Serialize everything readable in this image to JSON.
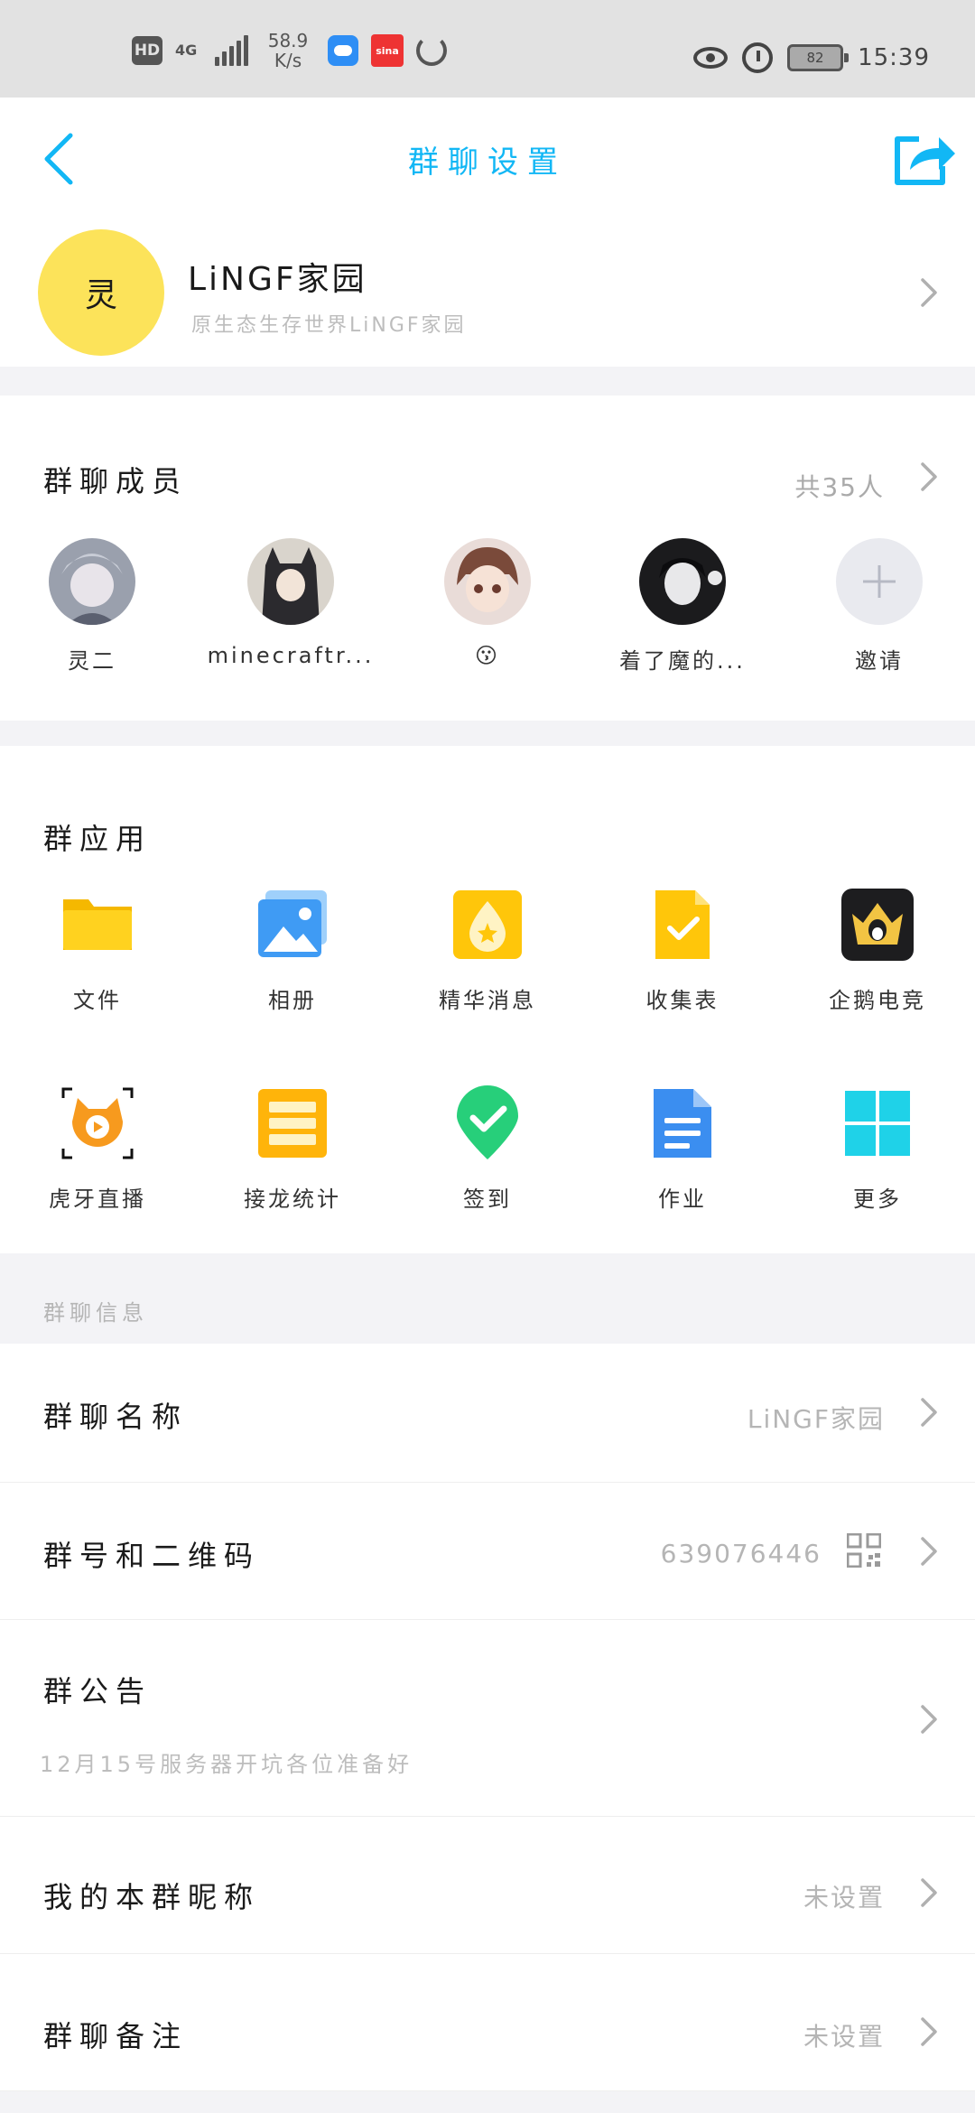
{
  "status_bar": {
    "hd": "HD",
    "network": "4G",
    "speed_value": "58.9",
    "speed_unit": "K/s",
    "sina_label": "sina",
    "battery": "82",
    "time": "15:39"
  },
  "title_bar": {
    "title": "群聊设置"
  },
  "group": {
    "avatar_char": "灵",
    "name": "LiNGF家园",
    "description": "原生态生存世界LiNGF家园"
  },
  "members": {
    "title": "群聊成员",
    "count": "共35人",
    "items": [
      {
        "name": "灵二"
      },
      {
        "name": "minecraftr..."
      },
      {
        "name": "😗"
      },
      {
        "name": "着了魔的..."
      },
      {
        "name": "邀请"
      }
    ]
  },
  "apps": {
    "title": "群应用",
    "items": [
      {
        "label": "文件",
        "icon": "folder-icon"
      },
      {
        "label": "相册",
        "icon": "photo-album-icon"
      },
      {
        "label": "精华消息",
        "icon": "featured-message-icon"
      },
      {
        "label": "收集表",
        "icon": "collection-form-icon"
      },
      {
        "label": "企鹅电竞",
        "icon": "penguin-esports-icon"
      },
      {
        "label": "虎牙直播",
        "icon": "huya-live-icon"
      },
      {
        "label": "接龙统计",
        "icon": "relay-stats-icon"
      },
      {
        "label": "签到",
        "icon": "check-in-icon"
      },
      {
        "label": "作业",
        "icon": "homework-icon"
      },
      {
        "label": "更多",
        "icon": "more-apps-icon"
      }
    ]
  },
  "info": {
    "header": "群聊信息",
    "name_label": "群聊名称",
    "name_value": "LiNGF家园",
    "number_label": "群号和二维码",
    "number_value": "639076446",
    "notice_label": "群公告",
    "notice_text": "12月15号服务器开坑各位准备好",
    "nickname_label": "我的本群昵称",
    "nickname_value": "未设置",
    "remark_label": "群聊备注",
    "remark_value": "未设置"
  },
  "colors": {
    "accent": "#12b7f5",
    "avatar_yellow": "#fce35a",
    "muted_text": "#b5b5b5",
    "section_gap": "#f3f3f6"
  }
}
